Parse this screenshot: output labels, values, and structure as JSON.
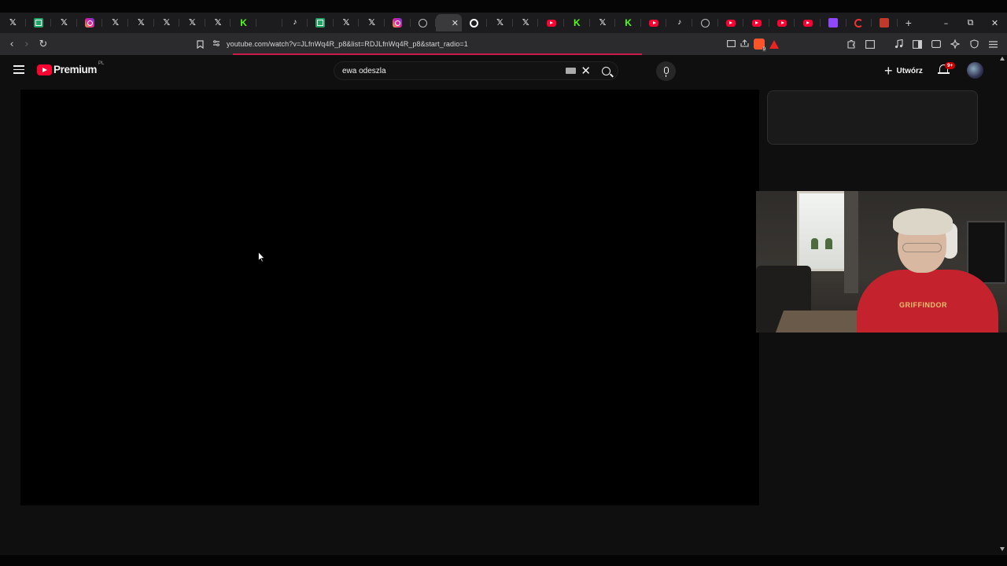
{
  "browser": {
    "tabs": [
      {
        "icon": "x-icon"
      },
      {
        "icon": "sheets-icon"
      },
      {
        "icon": "x-icon"
      },
      {
        "icon": "instagram-icon"
      },
      {
        "icon": "x-icon"
      },
      {
        "icon": "x-icon"
      },
      {
        "icon": "x-icon"
      },
      {
        "icon": "x-icon"
      },
      {
        "icon": "x-icon"
      },
      {
        "icon": "kick-icon"
      },
      {
        "icon": "blank-icon"
      },
      {
        "icon": "tiktok-icon"
      },
      {
        "icon": "sheets-icon"
      },
      {
        "icon": "x-icon"
      },
      {
        "icon": "x-icon"
      },
      {
        "icon": "instagram-icon"
      },
      {
        "icon": "globe-icon"
      },
      {
        "icon": "blank-icon",
        "active": true,
        "close": "✕"
      },
      {
        "icon": "google-icon"
      },
      {
        "icon": "x-icon"
      },
      {
        "icon": "x-icon"
      },
      {
        "icon": "youtube-icon"
      },
      {
        "icon": "kick-icon"
      },
      {
        "icon": "x-icon"
      },
      {
        "icon": "kick-icon"
      },
      {
        "icon": "youtube-icon"
      },
      {
        "icon": "tiktok-icon"
      },
      {
        "icon": "globe-icon"
      },
      {
        "icon": "youtube-icon"
      },
      {
        "icon": "youtube-icon"
      },
      {
        "icon": "youtube-icon"
      },
      {
        "icon": "youtube-icon"
      },
      {
        "icon": "twitch-icon"
      },
      {
        "icon": "loading-icon"
      },
      {
        "icon": "chart-icon"
      }
    ],
    "new_tab_label": "+",
    "window_controls": {
      "minimize": "–",
      "restore": "⧉",
      "close": "✕"
    },
    "nav": {
      "back": "‹",
      "forward": "›",
      "reload": "↻"
    },
    "url": "youtube.com/watch?v=JLfnWq4R_p8&list=RDJLfnWq4R_p8&start_radio=1",
    "accent_color": "#cc1b4a"
  },
  "youtube": {
    "logo_text": "Premium",
    "country_code": "PL",
    "search": {
      "value": "ewa odeszla",
      "clear": "✕"
    },
    "create_label": "Utwórz",
    "create_plus": "+",
    "notification_badge": "9+",
    "brand_color": "#ff0033"
  },
  "webcam_overlay": {
    "shirt_print": "GRIFFINDOR"
  }
}
